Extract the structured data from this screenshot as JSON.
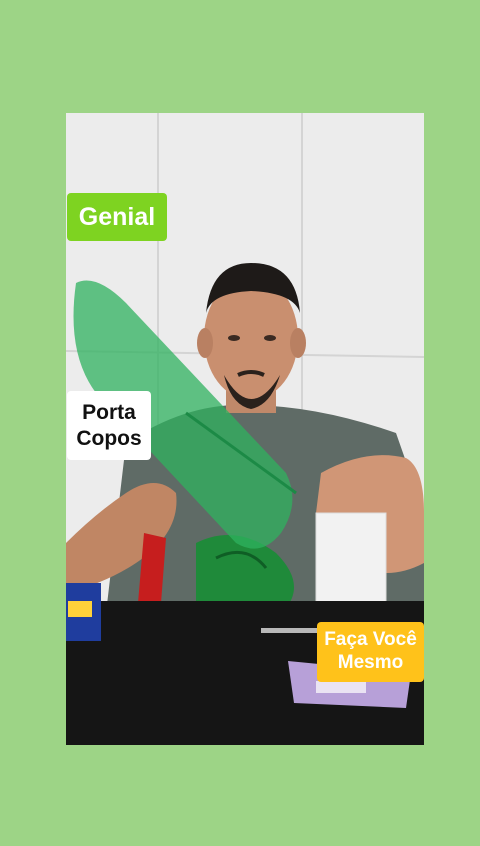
{
  "overlay_labels": {
    "genial": "Genial",
    "porta_line1": "Porta",
    "porta_line2": "Copos",
    "faca_line1": "Faça Você",
    "faca_line2": "Mesmo"
  },
  "colors": {
    "page_background": "#9dd486",
    "genial_badge": "#7ed321",
    "faca_badge": "#ffc21a",
    "porta_badge": "#ffffff"
  }
}
